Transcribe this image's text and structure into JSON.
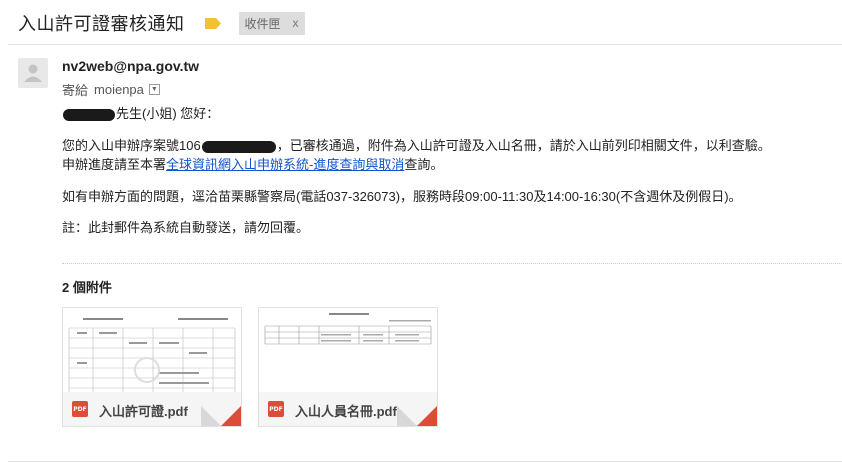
{
  "header": {
    "subject": "入山許可證審核通知",
    "label": "收件匣",
    "label_remove": "x"
  },
  "sender": {
    "email": "nv2web@npa.gov.tw",
    "to_label": "寄給",
    "to_name": "moienpa"
  },
  "body": {
    "greeting_suffix": "先生(小姐) 您好：",
    "para1_prefix": "您的入山申辦序案號106",
    "para1_suffix": "，已審核通過，附件為入山許可證及入山名冊，請於入山前列印相關文件，以利查驗。",
    "para1_line2_prefix": "申辦進度請至本署",
    "para1_link": "全球資訊網入山申辦系統-進度查詢與取消",
    "para1_line2_suffix": "查詢。",
    "para2": "如有申辦方面的問題，逕洽苗栗縣警察局(電話037-326073)，服務時段09:00-11:30及14:00-16:30(不含週休及例假日)。",
    "para3": "註：此封郵件為系統自動發送，請勿回覆。"
  },
  "attachments": {
    "title": "2 個附件",
    "items": [
      {
        "name": "入山許可證.pdf",
        "type_label": "PDF"
      },
      {
        "name": "入山人員名冊.pdf",
        "type_label": "PDF"
      }
    ]
  },
  "colors": {
    "accent_red": "#dd4b39",
    "link": "#1155cc",
    "important_marker": "#f1c232"
  }
}
